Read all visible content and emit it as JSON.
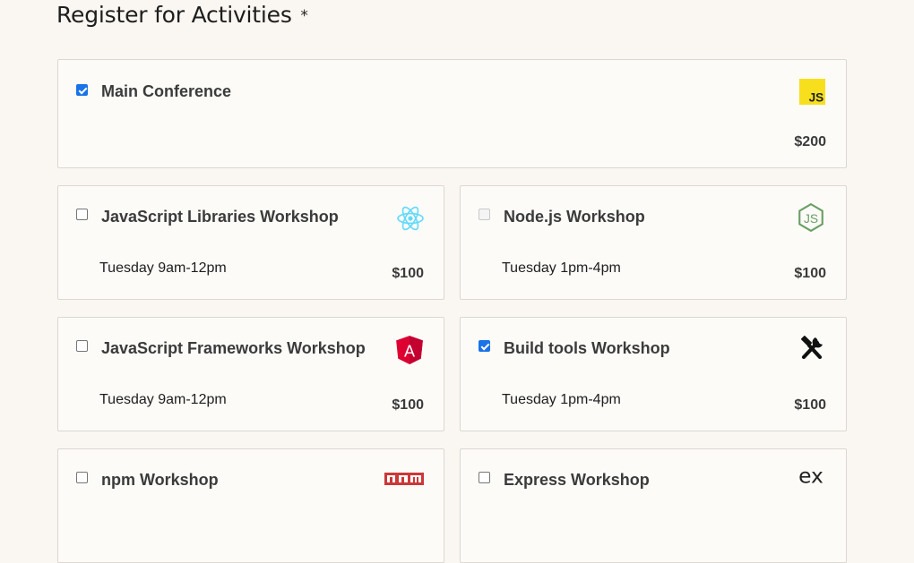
{
  "page": {
    "title": "Register for Activities",
    "required_mark": "*"
  },
  "main_activity": {
    "name": "Main Conference",
    "price": "$200",
    "checked": true,
    "icon": "javascript-logo-icon",
    "icon_text": "JS"
  },
  "workshops": [
    {
      "name": "JavaScript Libraries Workshop",
      "time": "Tuesday 9am-12pm",
      "price": "$100",
      "checked": false,
      "disabled": false,
      "icon": "react-logo-icon"
    },
    {
      "name": "Node.js Workshop",
      "time": "Tuesday 1pm-4pm",
      "price": "$100",
      "checked": false,
      "disabled": true,
      "icon": "nodejs-logo-icon",
      "icon_text": "JS"
    },
    {
      "name": "JavaScript Frameworks Workshop",
      "time": "Tuesday 9am-12pm",
      "price": "$100",
      "checked": false,
      "disabled": false,
      "icon": "angular-logo-icon",
      "icon_text": "A"
    },
    {
      "name": "Build tools Workshop",
      "time": "Tuesday 1pm-4pm",
      "price": "$100",
      "checked": true,
      "disabled": false,
      "icon": "tools-icon"
    },
    {
      "name": "npm Workshop",
      "checked": false,
      "disabled": false,
      "icon": "npm-logo-icon"
    },
    {
      "name": "Express Workshop",
      "checked": false,
      "disabled": false,
      "icon": "express-logo-icon",
      "icon_text": "ex"
    }
  ],
  "colors": {
    "background": "#faf6f1",
    "card_background": "#fdfbf8",
    "card_border": "#dcd7d0",
    "checkbox_checked": "#1a73e8",
    "js_yellow": "#f7df1e",
    "react_cyan": "#61dafb",
    "node_green": "#68a063",
    "angular_red": "#dd0031",
    "npm_red": "#cb3837"
  }
}
